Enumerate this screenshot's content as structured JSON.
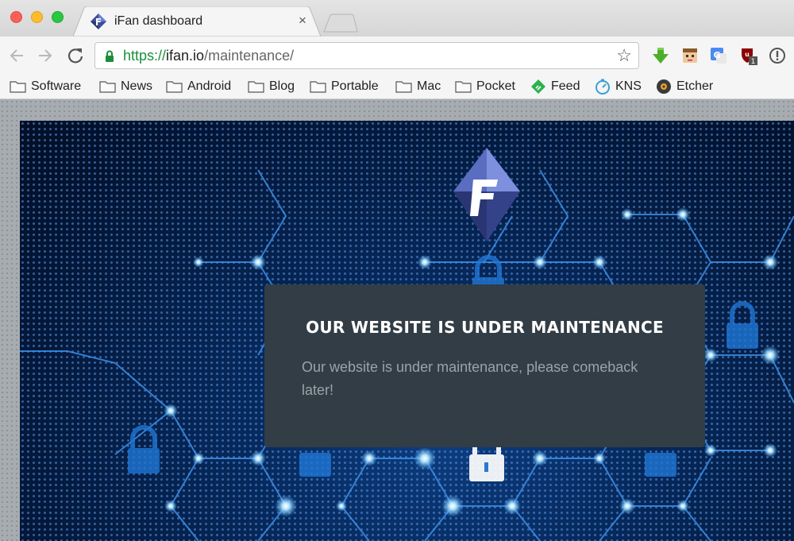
{
  "browser": {
    "tab": {
      "title": "iFan dashboard",
      "close_glyph": "×"
    },
    "url": {
      "scheme": "https://",
      "host": "ifan.io",
      "path": "/maintenance/"
    },
    "bookmarks": [
      {
        "label": "Software",
        "icon": "folder-icon"
      },
      {
        "label": "News",
        "icon": "folder-icon"
      },
      {
        "label": "Android",
        "icon": "folder-icon"
      },
      {
        "label": "Blog",
        "icon": "folder-icon"
      },
      {
        "label": "Portable",
        "icon": "folder-icon"
      },
      {
        "label": "Mac",
        "icon": "folder-icon"
      },
      {
        "label": "Pocket",
        "icon": "folder-icon"
      },
      {
        "label": "Feed",
        "icon": "feedly-icon"
      },
      {
        "label": "KNS",
        "icon": "kns-icon"
      },
      {
        "label": "Etcher",
        "icon": "etcher-icon"
      }
    ],
    "extension_badge": "1"
  },
  "page": {
    "maintenance_title": "OUR WEBSITE IS UNDER MAINTENANCE",
    "maintenance_text": "Our website is under maintenance, please comeback later!"
  },
  "colors": {
    "secure_green": "#1a8f3a",
    "box_bg": "#333d45",
    "hero_blue": "#06285a",
    "glow": "#7fd0ff"
  }
}
